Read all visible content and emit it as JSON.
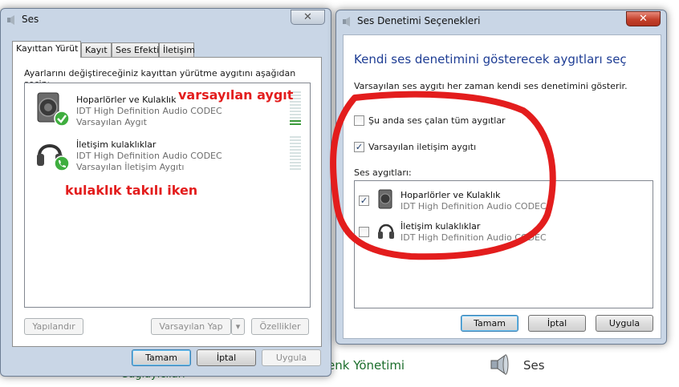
{
  "background": {
    "items": [
      "enk Yönetimi",
      "Ses"
    ],
    "partial_text": "Sagiayıcıları"
  },
  "left_window": {
    "title": "Ses",
    "close_label": "✕",
    "tabs": [
      {
        "label": "Kayıttan Yürüt",
        "active": true
      },
      {
        "label": "Kayıt",
        "active": false
      },
      {
        "label": "Ses Efekti",
        "active": false
      },
      {
        "label": "İletişim",
        "active": false
      }
    ],
    "instruction": "Ayarlarını değiştireceğiniz kayıttan yürütme aygıtını aşağıdan seçin:",
    "devices": [
      {
        "name": "Hoparlörler ve Kulaklık",
        "driver": "IDT High Definition Audio CODEC",
        "status": "Varsayılan Aygıt",
        "icon": "speaker-icon",
        "badge": "checkmark-badge-icon",
        "level_on": 2
      },
      {
        "name": "İletişim kulaklıklar",
        "driver": "IDT High Definition Audio CODEC",
        "status": "Varsayılan İletişim Aygıtı",
        "icon": "headphones-icon",
        "badge": "phone-badge-icon",
        "level_on": 0
      }
    ],
    "buttons": {
      "configure": "Yapılandır",
      "set_default": "Varsayılan Yap",
      "properties": "Özellikler",
      "ok": "Tamam",
      "cancel": "İptal",
      "apply": "Uygula"
    }
  },
  "annotations": {
    "default_device": "varsayılan aygıt",
    "headphones_plugged": "kulaklık takılı iken"
  },
  "right_window": {
    "title": "Ses Denetimi Seçenekleri",
    "close_label": "✕",
    "heading": "Kendi ses denetimini gösterecek aygıtları seç",
    "description": "Varsayılan ses aygıtı her zaman kendi ses denetimini gösterir.",
    "options": [
      {
        "label": "Şu anda ses çalan tüm aygıtlar",
        "checked": false
      },
      {
        "label": "Varsayılan iletişim aygıtı",
        "checked": true
      }
    ],
    "devices_label": "Ses aygıtları:",
    "devices": [
      {
        "name": "Hoparlörler ve Kulaklık",
        "driver": "IDT High Definition Audio CODEC",
        "checked": true,
        "icon": "speaker-icon"
      },
      {
        "name": "İletişim kulaklıklar",
        "driver": "IDT High Definition Audio CODEC",
        "checked": false,
        "icon": "headphones-icon"
      }
    ],
    "buttons": {
      "ok": "Tamam",
      "cancel": "İptal",
      "apply": "Uygula"
    }
  },
  "colors": {
    "annotation_red": "#e31d1d",
    "heading_blue": "#1e3d94",
    "level_green": "#3c9a3c",
    "check_green": "#3fae3f"
  }
}
